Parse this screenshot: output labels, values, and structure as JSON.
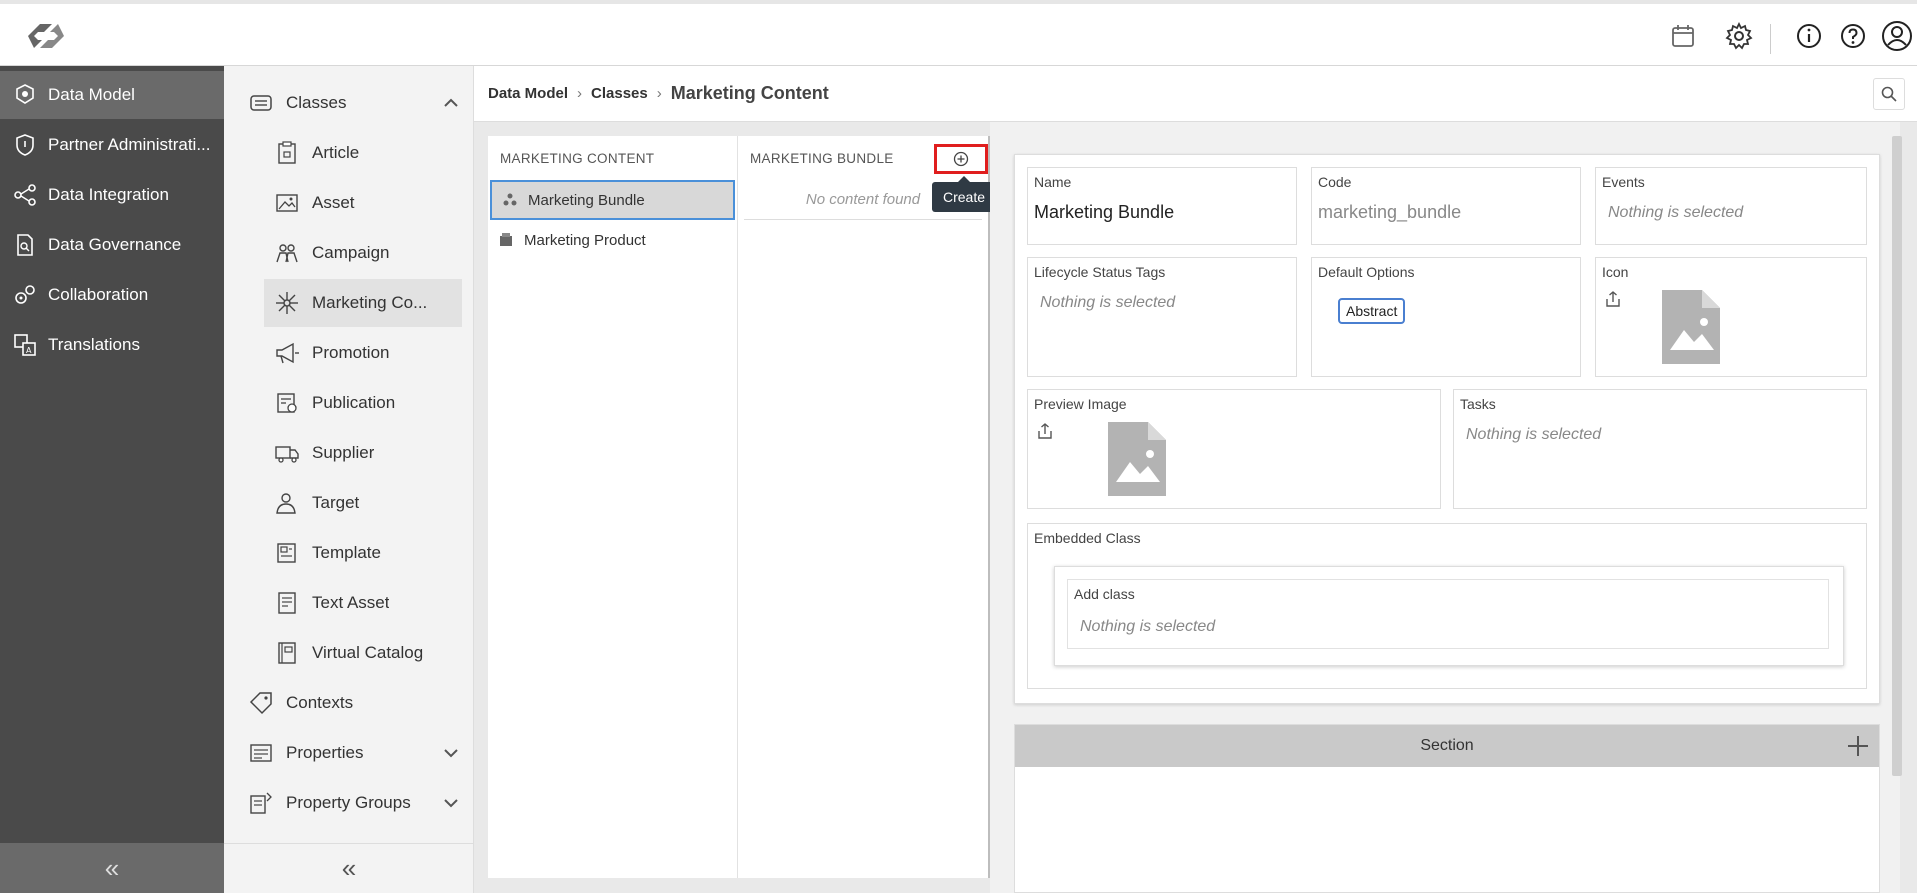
{
  "nav": {
    "items": [
      {
        "label": "Data Model",
        "icon": "cubes-icon",
        "active": true
      },
      {
        "label": "Partner Administrati...",
        "icon": "shield-icon"
      },
      {
        "label": "Data Integration",
        "icon": "share-nodes-icon"
      },
      {
        "label": "Data Governance",
        "icon": "document-search-icon"
      },
      {
        "label": "Collaboration",
        "icon": "gears-icon"
      },
      {
        "label": "Translations",
        "icon": "translate-icon"
      }
    ],
    "collapse_label": "«"
  },
  "sidebar": {
    "sections": [
      {
        "label": "Classes",
        "icon": "list-icon",
        "expanded": true
      },
      {
        "label": "Contexts",
        "icon": "tag-icon"
      },
      {
        "label": "Properties",
        "icon": "properties-icon",
        "expanded": false
      },
      {
        "label": "Property Groups",
        "icon": "property-groups-icon",
        "expanded": false
      }
    ],
    "classes": [
      {
        "label": "Article",
        "icon": "article-icon"
      },
      {
        "label": "Asset",
        "icon": "image-icon"
      },
      {
        "label": "Campaign",
        "icon": "people-icon"
      },
      {
        "label": "Marketing Co...",
        "icon": "network-icon",
        "active": true
      },
      {
        "label": "Promotion",
        "icon": "megaphone-icon"
      },
      {
        "label": "Publication",
        "icon": "publication-icon"
      },
      {
        "label": "Supplier",
        "icon": "truck-icon"
      },
      {
        "label": "Target",
        "icon": "person-icon"
      },
      {
        "label": "Template",
        "icon": "template-icon"
      },
      {
        "label": "Text Asset",
        "icon": "text-asset-icon"
      },
      {
        "label": "Virtual Catalog",
        "icon": "catalog-icon"
      }
    ],
    "collapse_label": "«"
  },
  "breadcrumb": {
    "items": [
      "Data Model",
      "Classes"
    ],
    "current": "Marketing Content"
  },
  "columns": {
    "col1": {
      "header": "MARKETING CONTENT",
      "rows": [
        "Marketing Bundle",
        "Marketing Product"
      ]
    },
    "col2": {
      "header": "MARKETING BUNDLE",
      "empty": "No content found",
      "tooltip": "Create"
    }
  },
  "detail": {
    "name": {
      "label": "Name",
      "value": "Marketing Bundle"
    },
    "code": {
      "label": "Code",
      "value": "marketing_bundle"
    },
    "events": {
      "label": "Events",
      "placeholder": "Nothing is selected"
    },
    "lifecycle": {
      "label": "Lifecycle Status Tags",
      "placeholder": "Nothing is selected"
    },
    "default_options": {
      "label": "Default Options",
      "chip": "Abstract"
    },
    "icon": {
      "label": "Icon"
    },
    "preview_image": {
      "label": "Preview Image"
    },
    "tasks": {
      "label": "Tasks",
      "placeholder": "Nothing is selected"
    },
    "embedded": {
      "label": "Embedded Class",
      "add_label": "Add class",
      "placeholder": "Nothing is selected"
    },
    "section": {
      "label": "Section"
    }
  },
  "colors": {
    "nav_bg": "#4a4a4a",
    "highlight": "#e01e1e",
    "selection_border": "#4a90d9"
  }
}
